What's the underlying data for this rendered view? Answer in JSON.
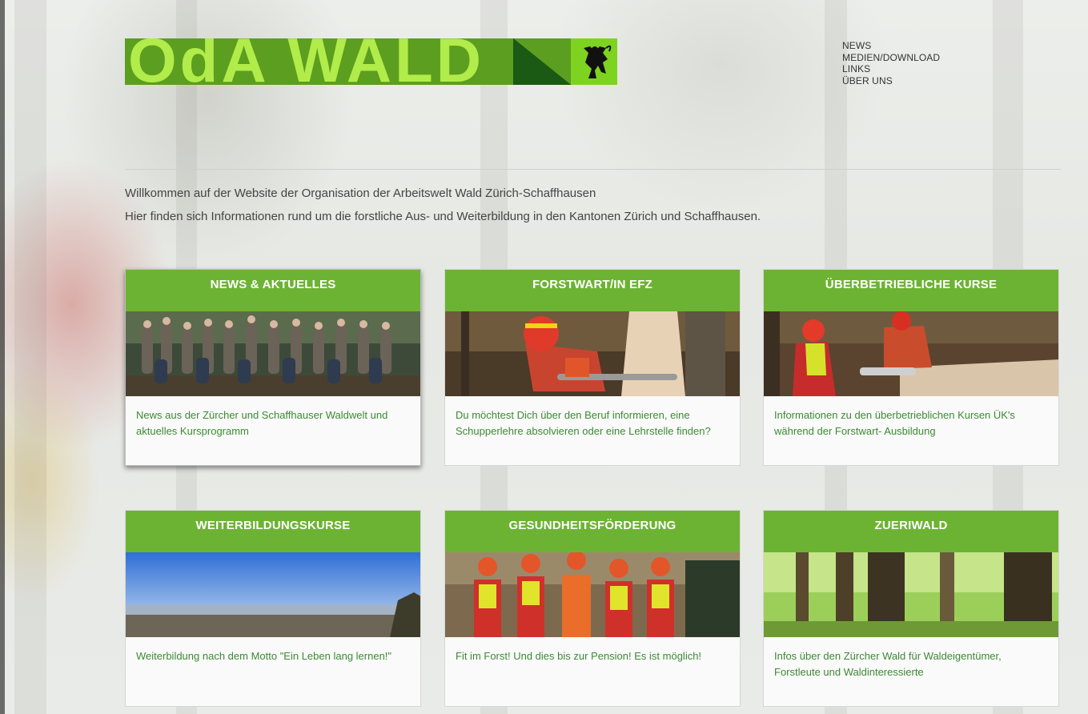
{
  "logo": {
    "text": "OdA WALD",
    "emblem": "zurich-lion-icon"
  },
  "nav": {
    "items": [
      "NEWS",
      "MEDIEN/DOWNLOAD",
      "LINKS",
      "ÜBER UNS"
    ]
  },
  "intro": {
    "line1": "Willkommen auf der Website der Organisation der Arbeitswelt Wald Zürich-Schaffhausen",
    "line2": "Hier finden sich Informationen rund um die forstliche Aus- und Weiterbildung in den Kantonen Zürich und Schaffhausen."
  },
  "cards": [
    {
      "title": "NEWS & AKTUELLES",
      "text": "News aus der Zürcher und Schaffhauser Waldwelt und aktuelles Kursprogramm"
    },
    {
      "title": "FORSTWART/IN EFZ",
      "text": "Du möchtest Dich über den Beruf informieren, eine Schupperlehre absolvieren oder eine Lehrstelle finden?"
    },
    {
      "title": "ÜBERBETRIEBLICHE KURSE",
      "text": "Informationen zu den überbetrieblichen Kursen ÜK's während der Forstwart- Ausbildung"
    },
    {
      "title": "WEITERBILDUNGSKURSE",
      "text": "Weiterbildung nach dem Motto \"Ein Leben lang lernen!\""
    },
    {
      "title": "GESUNDHEITSFÖRDERUNG",
      "text": "Fit im Forst! Und dies bis zur Pension! Es ist möglich!"
    },
    {
      "title": "ZUERIWALD",
      "text": "Infos über den Zürcher Wald für Waldeigentümer, Forstleute und Waldinteressierte"
    }
  ],
  "colors": {
    "accent_green": "#6db333",
    "link_green": "#3c8a33",
    "logo_green": "#5c9e1f",
    "logo_light": "#b1ec4a"
  }
}
